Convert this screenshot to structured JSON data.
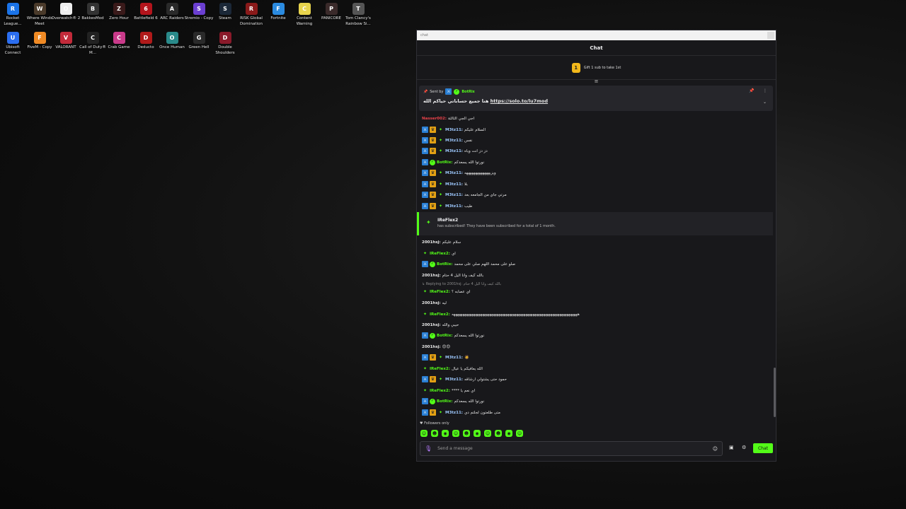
{
  "desktop": {
    "icons": [
      {
        "label": "Rocket League...",
        "color": "#1a73e8",
        "glyph": "R"
      },
      {
        "label": "Where Winds Meet",
        "color": "#4a3a2a",
        "glyph": "W"
      },
      {
        "label": "Overwatch® 2",
        "color": "#eeeeee",
        "glyph": "O"
      },
      {
        "label": "BakkesMod",
        "color": "#333333",
        "glyph": "B"
      },
      {
        "label": "Zero Hour",
        "color": "#3a1a1a",
        "glyph": "Z"
      },
      {
        "label": "Battlefield 6",
        "color": "#b3141c",
        "glyph": "6"
      },
      {
        "label": "ARC Raiders",
        "color": "#2a2a2a",
        "glyph": "A"
      },
      {
        "label": "Stremio - Copy",
        "color": "#6b3fd1",
        "glyph": "S"
      },
      {
        "label": "Steam",
        "color": "#1b2838",
        "glyph": "S"
      },
      {
        "label": "RISK Global Domination",
        "color": "#8a1a1a",
        "glyph": "R"
      },
      {
        "label": "Fortnite",
        "color": "#2b8be0",
        "glyph": "F"
      },
      {
        "label": "Content Warning",
        "color": "#e8d44d",
        "glyph": "C"
      },
      {
        "label": "PANICORE",
        "color": "#3a2a2a",
        "glyph": "P"
      },
      {
        "label": "Tom Clancy's Rainbow Si...",
        "color": "#555555",
        "glyph": "T"
      },
      {
        "label": "Ubisoft Connect",
        "color": "#2b6ef0",
        "glyph": "U"
      },
      {
        "label": "FiveM - Copy",
        "color": "#f08a24",
        "glyph": "F"
      },
      {
        "label": "VALORANT",
        "color": "#c22a3a",
        "glyph": "V"
      },
      {
        "label": "Call of Duty® M...",
        "color": "#222222",
        "glyph": "C"
      },
      {
        "label": "Crab Game",
        "color": "#c93a8a",
        "glyph": "C"
      },
      {
        "label": "Deducto",
        "color": "#b01a1a",
        "glyph": "D"
      },
      {
        "label": "Once Human",
        "color": "#2a8a8a",
        "glyph": "O"
      },
      {
        "label": "Green Hell",
        "color": "#2a2a2a",
        "glyph": "G"
      },
      {
        "label": "Double Shoulders",
        "color": "#8a1a2a",
        "glyph": "D"
      }
    ]
  },
  "window": {
    "title": "chat"
  },
  "chat": {
    "header": "Chat",
    "gift_badge": "1",
    "gift_text": "Gift 1 sub to take 1st",
    "pinned": {
      "sent_by_label": "Sent by",
      "sender": "BotRix",
      "message": "هنا جميع حساباتي حياكم الله",
      "link": "https://solo.to/lu7mod"
    },
    "first_line_user": "Nasser002:",
    "first_line_text": "اجي الجي الثالثة",
    "messages_top": [
      {
        "user": "M3tz11:",
        "cls": "u-m3tz",
        "badges": [
          "mod",
          "vip",
          "sub"
        ],
        "text": "السلام عليكم"
      },
      {
        "user": "M3tz11:",
        "cls": "u-m3tz",
        "badges": [
          "mod",
          "vip",
          "sub"
        ],
        "text": "نفس"
      },
      {
        "user": "M3tz11:",
        "cls": "u-m3tz",
        "badges": [
          "mod",
          "vip",
          "sub"
        ],
        "text": "دز دز انت وياه"
      },
      {
        "user": "BotRix:",
        "cls": "u-bot",
        "badges": [
          "mod",
          "ver"
        ],
        "text": "نورتوا الله يسعدكم"
      },
      {
        "user": "M3tz11:",
        "cls": "u-m3tz",
        "badges": [
          "mod",
          "vip",
          "sub"
        ],
        "text": "ويزيهههههههههههههه"
      },
      {
        "user": "M3tz11:",
        "cls": "u-m3tz",
        "badges": [
          "mod",
          "vip",
          "sub"
        ],
        "text": "بلا"
      },
      {
        "user": "M3tz11:",
        "cls": "u-m3tz",
        "badges": [
          "mod",
          "vip",
          "sub"
        ],
        "text": "مرتي جاي من الجامعه بعد"
      },
      {
        "user": "M3tz11:",
        "cls": "u-m3tz",
        "badges": [
          "mod",
          "vip",
          "sub"
        ],
        "text": "طيب"
      }
    ],
    "sub_event": {
      "name": "IReFlex2",
      "desc": "has subscribed! They have been subscribed for a total of 1 month."
    },
    "messages_bottom": [
      {
        "user": "2001hsj:",
        "cls": "u-2001",
        "badges": [],
        "text": "سلام عليكم"
      },
      {
        "user": "IReFlex2:",
        "cls": "u-ire",
        "badges": [
          "sub"
        ],
        "text": "اي"
      },
      {
        "user": "BotRix:",
        "cls": "u-bot",
        "badges": [
          "mod",
          "ver"
        ],
        "text": "صلو على محمد اللهم صلي على محمد"
      },
      {
        "user": "2001hsj:",
        "cls": "u-2001",
        "badges": [],
        "text": "بالله كيف وانا اليل 4 حتام"
      },
      {
        "user": "IReFlex2:",
        "cls": "u-ire",
        "badges": [
          "sub"
        ],
        "text": "اي عصابه ؟"
      },
      {
        "user": "2001hsj:",
        "cls": "u-2001",
        "badges": [],
        "text": "ليه"
      },
      {
        "user": "IReFlex2:",
        "cls": "u-ire",
        "badges": [
          "sub"
        ],
        "text": "ههههههههههههههههههههههههههههههههههههههههههههههههههههههههههههههههههههههه"
      },
      {
        "user": "2001hsj:",
        "cls": "u-2001",
        "badges": [],
        "text": "حيبي والله"
      },
      {
        "user": "BotRix:",
        "cls": "u-bot",
        "badges": [
          "mod",
          "ver"
        ],
        "text": "نورتوا الله يسعدكم"
      },
      {
        "user": "2001hsj:",
        "cls": "u-2001",
        "badges": [],
        "text": "😊😊"
      },
      {
        "user": "M3tz11:",
        "cls": "u-m3tz",
        "badges": [
          "mod",
          "vip",
          "sub"
        ],
        "text": "🧔"
      },
      {
        "user": "IReFlex2:",
        "cls": "u-ire",
        "badges": [
          "sub"
        ],
        "text": "الله يعافيكم يا عيال"
      },
      {
        "user": "M3tz11:",
        "cls": "u-m3tz",
        "badges": [
          "mod",
          "vip",
          "sub"
        ],
        "text": "حمود حتى يشتولي ارشاقه"
      },
      {
        "user": "IReFlex2:",
        "cls": "u-ire",
        "badges": [
          "sub"
        ],
        "text": "**** اي نعم يا"
      },
      {
        "user": "BotRix:",
        "cls": "u-bot",
        "badges": [
          "mod",
          "ver"
        ],
        "text": "نورتوا الله يسعدكم"
      },
      {
        "user": "M3tz11:",
        "cls": "u-m3tz",
        "badges": [
          "mod",
          "vip",
          "sub"
        ],
        "text": "متى طلعتون لجلتم دي"
      }
    ],
    "reply_text": "Replying to 2001hsj: بالله كيف وانا اليل 4 حتام",
    "followers_only": "Followers only",
    "input_placeholder": "Send a message",
    "send_button": "Chat"
  }
}
